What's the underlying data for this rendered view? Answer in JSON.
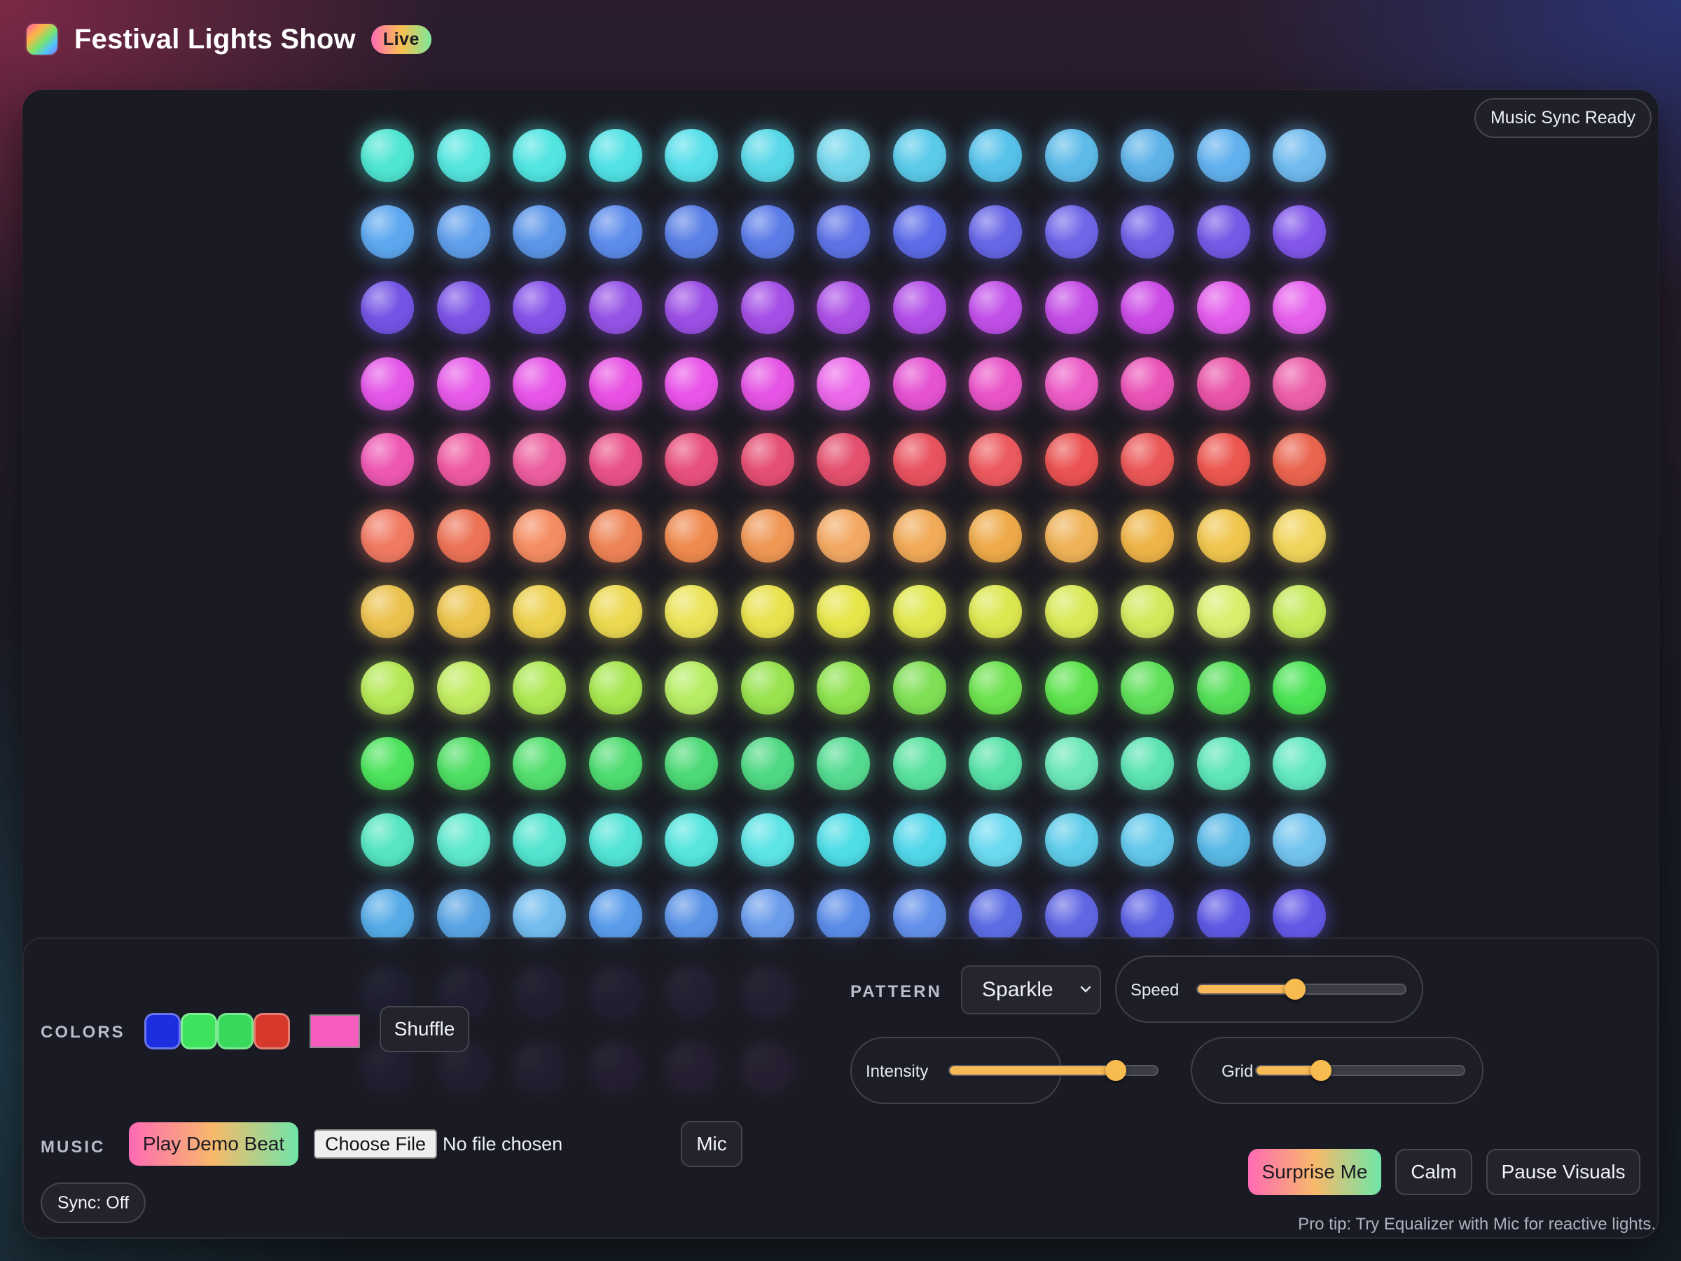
{
  "header": {
    "title": "Festival Lights Show",
    "badge": "Live",
    "logo_icon": "rainbow-gradient-logo"
  },
  "stage": {
    "sync_status": "Music Sync Ready",
    "grid": {
      "columns": 13,
      "rows": 13
    },
    "row_colors": [
      [
        "#4fe6d2",
        "#55e6df",
        "#52e5e2",
        "#52e2e6",
        "#57dfea",
        "#58d8e8",
        "#73d7ec",
        "#5bcbea",
        "#57c2ea",
        "#5ebbe9",
        "#5eb2e8",
        "#62b1ee",
        "#71bbef"
      ],
      [
        "#5da8ef",
        "#609feb",
        "#5c96e8",
        "#5d8ceb",
        "#5a80e6",
        "#5b7ce7",
        "#5f73e6",
        "#5d6ce8",
        "#6766e6",
        "#6f66e8",
        "#7260e6",
        "#7659e6",
        "#8257ea"
      ],
      [
        "#7454e5",
        "#7c53e6",
        "#8552e8",
        "#9553e5",
        "#9c50e5",
        "#a44fe6",
        "#ac50e6",
        "#b24fe8",
        "#c150e9",
        "#c54ee7",
        "#cc4be6",
        "#e35ceb",
        "#e660ec"
      ],
      [
        "#e457e8",
        "#e75ae9",
        "#e655e8",
        "#e851e3",
        "#e954e9",
        "#e554e4",
        "#ec69ea",
        "#e552d2",
        "#e954c7",
        "#ec5cc6",
        "#ea53b7",
        "#e954a8",
        "#ec5fa9"
      ],
      [
        "#ee58b2",
        "#ee5aa1",
        "#ec5e9e",
        "#e95288",
        "#e8507d",
        "#e54f73",
        "#e4506e",
        "#e95360",
        "#ec5a5f",
        "#eb5252",
        "#eb5757",
        "#ec5750",
        "#ea654f"
      ],
      [
        "#f07a62",
        "#ed7357",
        "#f58d62",
        "#ee8456",
        "#ef8a4f",
        "#ef9755",
        "#f3a964",
        "#f1aa58",
        "#eeaa4a",
        "#efb257",
        "#eeb448",
        "#f0c64f",
        "#f1d45b"
      ],
      [
        "#ecc24f",
        "#ecc44d",
        "#edd14e",
        "#ecd950",
        "#ebe458",
        "#e8e24d",
        "#e6e64b",
        "#e1e84e",
        "#dde74f",
        "#d9e957",
        "#d2e95c",
        "#d9ef6e",
        "#c5ea5a"
      ],
      [
        "#b5e856",
        "#c0ec60",
        "#aee853",
        "#a6e64e",
        "#b7ed64",
        "#98e34f",
        "#8ee24e",
        "#7fdf55",
        "#6de24f",
        "#5ee34e",
        "#60e05a",
        "#55df58",
        "#4ce355"
      ],
      [
        "#4de35c",
        "#4fde64",
        "#53df6f",
        "#4fdc71",
        "#4dd976",
        "#50d985",
        "#55dc92",
        "#59e29f",
        "#58e2a8",
        "#6ce8b9",
        "#5ce4b3",
        "#5ee6b9",
        "#63e8c2"
      ],
      [
        "#56e6c2",
        "#5ee9cd",
        "#53e5cf",
        "#52e4d6",
        "#56e6de",
        "#5de4e6",
        "#4fdde6",
        "#52d7ea",
        "#6bdaf0",
        "#5fcdea",
        "#63c8ec",
        "#5ab9e6",
        "#73c4ef"
      ],
      [
        "#56abe6",
        "#5aa4e3",
        "#72bcee",
        "#5a9cea",
        "#5b93e6",
        "#6a9ceb",
        "#5b8ce8",
        "#6390ea",
        "#5c6de3",
        "#6167e3",
        "#5d62e3",
        "#5e5ae4",
        "#6258e6"
      ],
      [
        "#4a3fa6",
        "#5041a8",
        "#4f3fa6",
        "#5a44aa",
        "#6546ab",
        "#6b49ab",
        "#000000",
        "#000000",
        "#000000",
        "#000000",
        "#000000",
        "#000000",
        "#000000"
      ],
      [
        "#5f35a0",
        "#6a379f",
        "#70389f",
        "#7a3aa2",
        "#853ea5",
        "#8a3ea4",
        "#000000",
        "#000000",
        "#000000",
        "#000000",
        "#000000",
        "#000000",
        "#000000"
      ]
    ]
  },
  "colors": {
    "label": "COLORS",
    "swatches": [
      "#1b2fe0",
      "#3de35c",
      "#38d95a",
      "#d6392c"
    ],
    "picker": "#f75bbd",
    "shuffle_label": "Shuffle"
  },
  "music": {
    "label": "MUSIC",
    "play_label": "Play Demo Beat",
    "file_button": "Choose File",
    "file_status": "No file chosen",
    "mic_label": "Mic",
    "sync_label": "Sync: Off"
  },
  "pattern": {
    "label": "PATTERN",
    "selected": "Sparkle",
    "speed": {
      "label": "Speed",
      "value": 0.47
    },
    "intensity": {
      "label": "Intensity",
      "value": 0.8
    },
    "grid_size": {
      "label": "Grid",
      "value": 0.31
    }
  },
  "actions": {
    "surprise_label": "Surprise Me",
    "calm_label": "Calm",
    "pause_label": "Pause Visuals"
  },
  "footer": {
    "pro_tip": "Pro tip: Try Equalizer with Mic for reactive lights."
  }
}
